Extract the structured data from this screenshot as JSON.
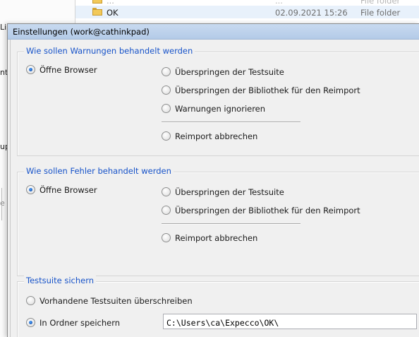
{
  "background_window": {
    "files": [
      {
        "name": "...",
        "date": "...",
        "type": "File folder"
      },
      {
        "name": "OK",
        "date": "02.09.2021 15:26",
        "type": "File folder"
      }
    ],
    "edge_fragments": [
      "Li",
      "nt",
      "up",
      "e fi"
    ]
  },
  "dialog": {
    "title": "Einstellungen (work@cathinkpad)",
    "warnings_group": {
      "title": "Wie sollen Warnungen behandelt werden",
      "options": [
        {
          "label": "Öffne Browser",
          "checked": true
        },
        {
          "label": "Überspringen der Testsuite",
          "checked": false
        },
        {
          "label": "Überspringen der Bibliothek für den Reimport",
          "checked": false
        },
        {
          "label": "Warnungen ignorieren",
          "checked": false
        },
        {
          "label": "Reimport abbrechen",
          "checked": false
        }
      ]
    },
    "errors_group": {
      "title": "Wie sollen Fehler behandelt werden",
      "options": [
        {
          "label": "Öffne Browser",
          "checked": true
        },
        {
          "label": "Überspringen der Testsuite",
          "checked": false
        },
        {
          "label": "Überspringen der Bibliothek für den Reimport",
          "checked": false
        },
        {
          "label": "Reimport abbrechen",
          "checked": false
        }
      ]
    },
    "save_group": {
      "title": "Testsuite sichern",
      "options": [
        {
          "label": "Vorhandene Testsuiten überschreiben",
          "checked": false
        },
        {
          "label": "In Ordner speichern",
          "checked": true
        }
      ],
      "folder_path": "C:\\Users\\ca\\Expecco\\OK\\"
    }
  }
}
